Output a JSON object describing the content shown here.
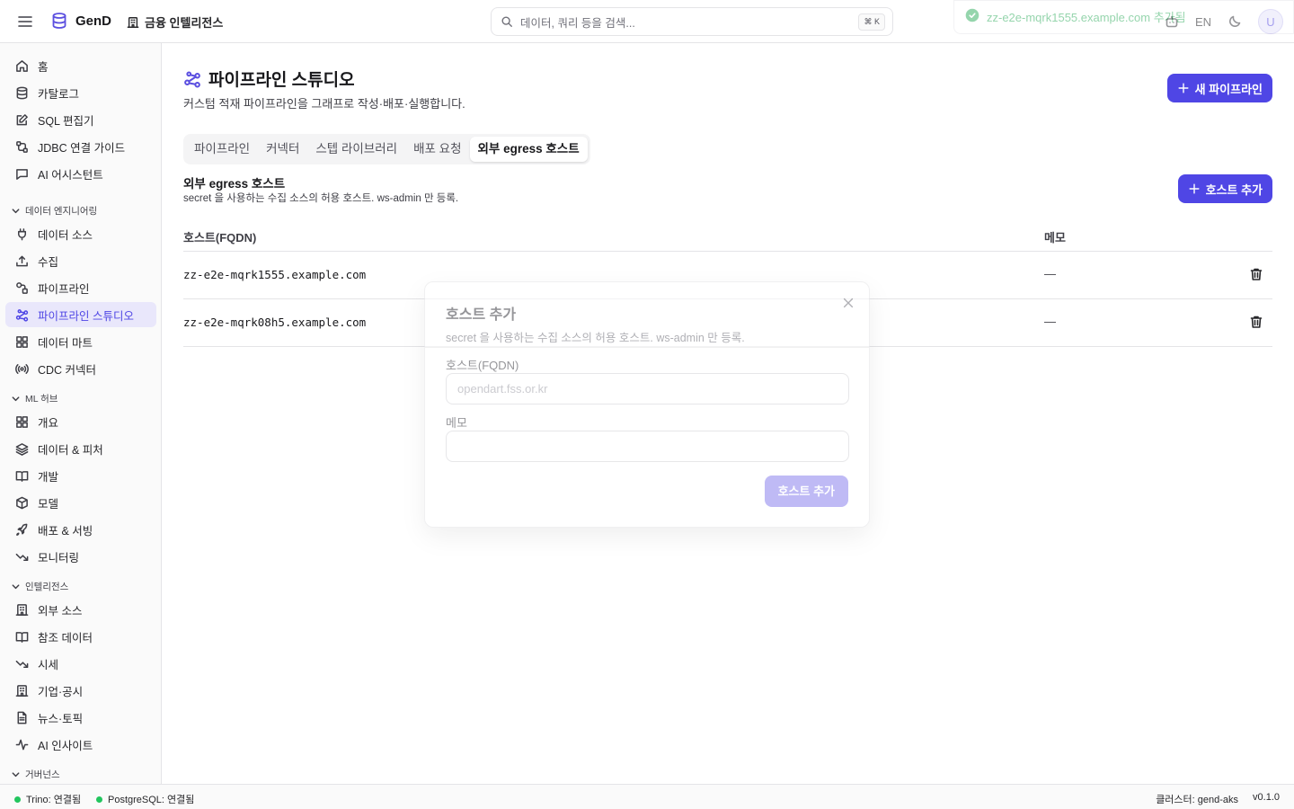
{
  "header": {
    "app_name": "GenD",
    "workspace": "금융 인텔리전스",
    "search_placeholder": "데이터, 쿼리 등을 검색...",
    "search_shortcut": "⌘ K",
    "language": "EN",
    "avatar_initial": "U"
  },
  "sidebar": {
    "items_top": [
      {
        "label": "홈",
        "icon": "home-icon"
      },
      {
        "label": "카탈로그",
        "icon": "database-icon"
      },
      {
        "label": "SQL 편집기",
        "icon": "edit-icon"
      },
      {
        "label": "JDBC 연결 가이드",
        "icon": "connection-icon"
      },
      {
        "label": "AI 어시스턴트",
        "icon": "chat-icon"
      }
    ],
    "group_data_eng": "데이터 엔지니어링",
    "items_data_eng": [
      {
        "label": "데이터 소스",
        "icon": "plug-icon"
      },
      {
        "label": "수집",
        "icon": "upload-icon"
      },
      {
        "label": "파이프라인",
        "icon": "pipeline-icon"
      },
      {
        "label": "파이프라인 스튜디오",
        "icon": "workflow-icon"
      },
      {
        "label": "데이터 마트",
        "icon": "grid-icon"
      },
      {
        "label": "CDC 커넥터",
        "icon": "broadcast-icon"
      }
    ],
    "group_ml": "ML 허브",
    "items_ml": [
      {
        "label": "개요",
        "icon": "grid-icon"
      },
      {
        "label": "데이터 & 피처",
        "icon": "layers-icon"
      },
      {
        "label": "개발",
        "icon": "book-icon"
      },
      {
        "label": "모델",
        "icon": "box-icon"
      },
      {
        "label": "배포 & 서빙",
        "icon": "rocket-icon"
      },
      {
        "label": "모니터링",
        "icon": "trend-icon"
      }
    ],
    "group_intel": "인텔리전스",
    "items_intel": [
      {
        "label": "외부 소스",
        "icon": "building-icon"
      },
      {
        "label": "참조 데이터",
        "icon": "book-icon"
      },
      {
        "label": "시세",
        "icon": "trend-icon"
      },
      {
        "label": "기업·공시",
        "icon": "building-icon"
      },
      {
        "label": "뉴스·토픽",
        "icon": "document-icon"
      },
      {
        "label": "AI 인사이트",
        "icon": "activity-icon"
      }
    ],
    "group_gov": "거버넌스"
  },
  "main": {
    "title": "파이프라인 스튜디오",
    "subtitle": "커스텀 적재 파이프라인을 그래프로 작성·배포·실행합니다.",
    "new_pipeline_label": "새 파이프라인",
    "tabs": [
      {
        "label": "파이프라인"
      },
      {
        "label": "커넥터"
      },
      {
        "label": "스텝 라이브러리"
      },
      {
        "label": "배포 요청"
      },
      {
        "label": "외부 egress 호스트"
      }
    ],
    "active_tab": "외부 egress 호스트",
    "section_title": "외부 egress 호스트",
    "section_subtitle": "secret 을 사용하는 수집 소스의 허용 호스트. ws-admin 만 등록.",
    "add_host_label": "호스트 추가",
    "table": {
      "col_host": "호스트(FQDN)",
      "col_memo": "메모",
      "rows": [
        {
          "host": "zz-e2e-mqrk1555.example.com",
          "memo": "—"
        },
        {
          "host": "zz-e2e-mqrk08h5.example.com",
          "memo": "—"
        }
      ]
    }
  },
  "dialog": {
    "title": "호스트 추가",
    "subtitle": "secret 을 사용하는 수집 소스의 허용 호스트. ws-admin 만 등록.",
    "host_label": "호스트(FQDN)",
    "host_placeholder": "opendart.fss.or.kr",
    "memo_label": "메모",
    "memo_value": "",
    "submit_label": "호스트 추가"
  },
  "toast": {
    "message": "zz-e2e-mqrk1555.example.com 추가됨"
  },
  "footer": {
    "trino_status": "Trino: 연결됨",
    "pg_status": "PostgreSQL: 연결됨",
    "cluster": "클러스터: gend-aks",
    "version": "v0.1.0"
  },
  "colors": {
    "accent": "#4f46e5",
    "active_bg": "#e9e7fb",
    "status_ok": "#22c55e"
  }
}
